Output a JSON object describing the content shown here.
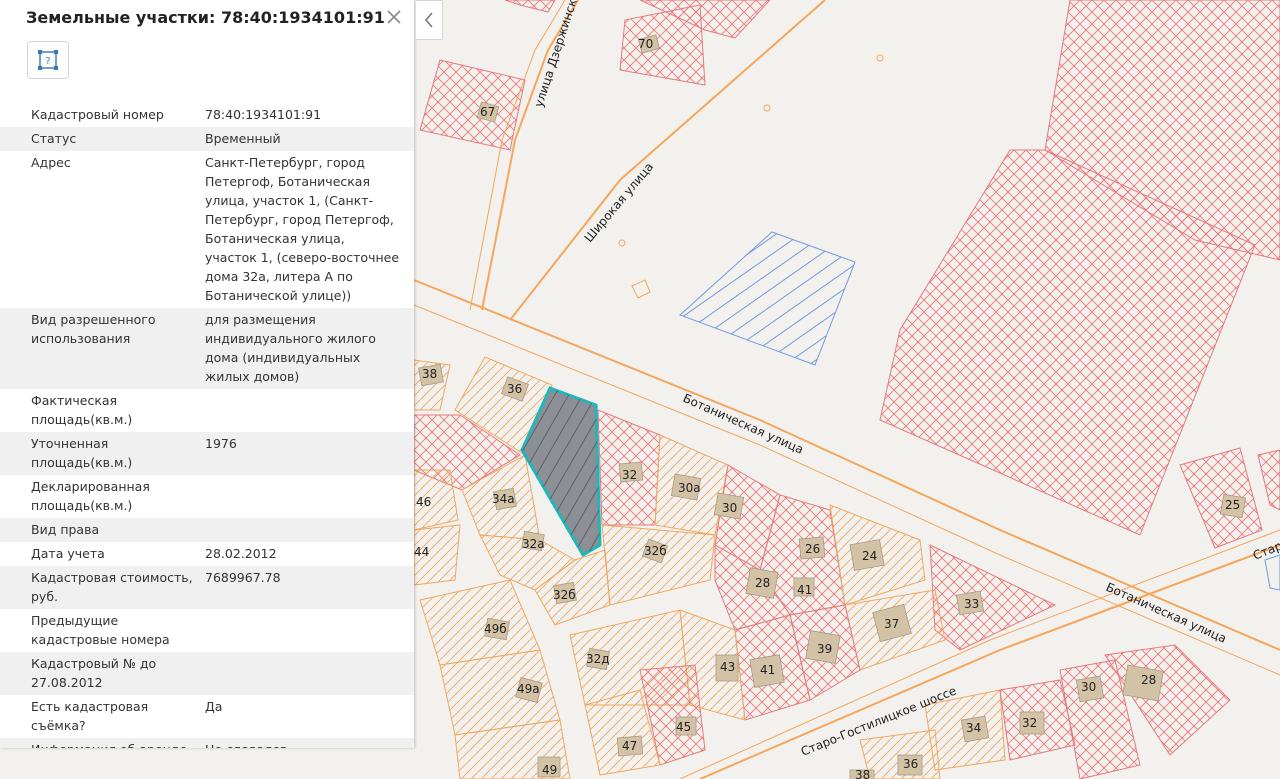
{
  "panel": {
    "title": "Земельные участки: 78:40:1934101:91",
    "close_icon": "close-icon",
    "tool_icon": "parcel-query-icon",
    "collapse_icon": "chevron-left-icon",
    "rows": [
      {
        "key": "Кадастровый номер",
        "value": "78:40:1934101:91"
      },
      {
        "key": "Статус",
        "value": "Временный"
      },
      {
        "key": "Адрес",
        "value": "Санкт-Петербург, город Петергоф, Ботаническая улица, участок 1, (Санкт-Петербург, город Петергоф, Ботаническая улица, участок 1, (северо-восточнее дома 32а, литера А по Ботанической улице))"
      },
      {
        "key": "Вид разрешенного использования",
        "value": "для размещения индивидуального жилого дома (индивидуальных жилых домов)"
      },
      {
        "key": "Фактическая площадь(кв.м.)",
        "value": ""
      },
      {
        "key": "Уточненная площадь(кв.м.)",
        "value": "1976"
      },
      {
        "key": "Декларированная площадь(кв.м.)",
        "value": ""
      },
      {
        "key": "Вид права",
        "value": ""
      },
      {
        "key": "Дата учета",
        "value": "28.02.2012"
      },
      {
        "key": "Кадастровая стоимость, руб.",
        "value": "7689967.78"
      },
      {
        "key": "Предыдущие кадастровые номера",
        "value": ""
      },
      {
        "key": "Кадастровый № до 27.08.2012",
        "value": ""
      },
      {
        "key": "Есть кадастровая съёмка?",
        "value": "Да"
      },
      {
        "key": "Информация об аренде",
        "value": "Не сдавался"
      }
    ]
  },
  "map": {
    "streets": {
      "dzerzhinsky": "улица Дзержинского",
      "shirokaya": "Широкая улица",
      "botanicheskaya_1": "Ботаническая улица",
      "botanicheskaya_2": "Ботаническая улица",
      "staro_gostilitskoe": "Старо-Гостилицкое шоссе",
      "staro_edge": "Старо"
    },
    "labels": {
      "l70": "70",
      "l67": "67",
      "l38": "38",
      "l36": "36",
      "l46": "46",
      "l44": "44",
      "l34a": "34а",
      "l32a": "32а",
      "l32b": "32б",
      "l32": "32",
      "l30a": "30а",
      "l30": "30",
      "l26": "26",
      "l24": "24",
      "l28": "28",
      "l41a": "41",
      "l33": "33",
      "l37": "37",
      "l39": "39",
      "l41b": "41",
      "l43": "43",
      "l32d": "32д",
      "l49b": "49б",
      "l49a": "49а",
      "l47": "47",
      "l45": "45",
      "l49": "49",
      "l34": "34",
      "l32c": "32",
      "l30b": "30",
      "l28b": "28",
      "l36b": "36",
      "l38b": "38",
      "l25": "25"
    },
    "colors": {
      "road": "#f5a65b",
      "parcel_red": "#e8797b",
      "parcel_orange": "#f0a860",
      "selected_fill": "#8c8f96",
      "selected_stroke": "#1fb7b9",
      "planned_blue": "#6f9be0",
      "building": "#d4c2a6"
    }
  }
}
